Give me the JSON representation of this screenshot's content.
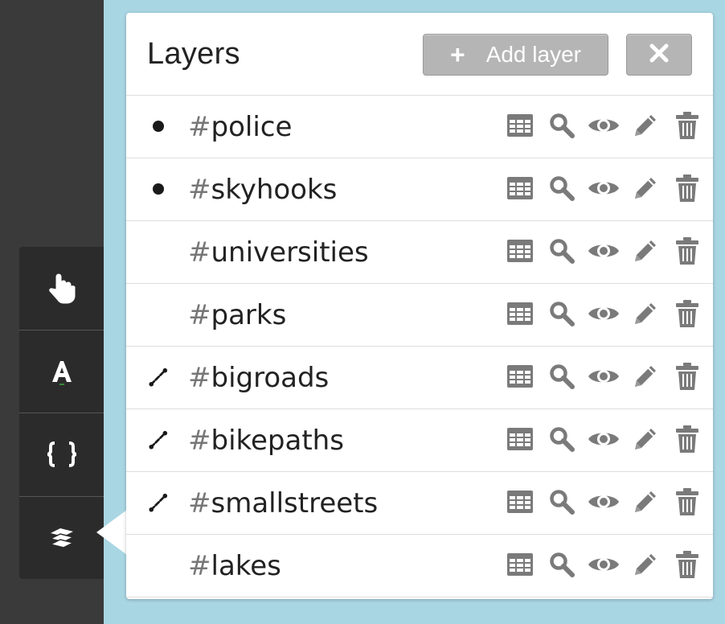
{
  "panel": {
    "title": "Layers",
    "add_button": {
      "icon": "plus-icon",
      "label": "Add layer"
    },
    "close_button": {
      "icon": "close-icon"
    }
  },
  "toolbar": {
    "items": [
      {
        "icon": "hand-pointer-icon"
      },
      {
        "icon": "text-font-icon"
      },
      {
        "icon": "curly-braces-icon"
      },
      {
        "icon": "layers-icon"
      }
    ]
  },
  "layers": [
    {
      "name": "police",
      "marker": "point"
    },
    {
      "name": "skyhooks",
      "marker": "point"
    },
    {
      "name": "universities",
      "marker": "none"
    },
    {
      "name": "parks",
      "marker": "none"
    },
    {
      "name": "bigroads",
      "marker": "line"
    },
    {
      "name": "bikepaths",
      "marker": "line"
    },
    {
      "name": "smallstreets",
      "marker": "line"
    },
    {
      "name": "lakes",
      "marker": "none"
    }
  ],
  "hash_symbol": "#",
  "layer_actions": [
    "table-icon",
    "search-icon",
    "eye-icon",
    "pencil-icon",
    "trash-icon"
  ],
  "colors": {
    "icon_gray": "#7a7a7a",
    "button_gray": "#b5b5b5",
    "map_water": "#a9d6e3",
    "sidebar": "#2b2b2b"
  }
}
